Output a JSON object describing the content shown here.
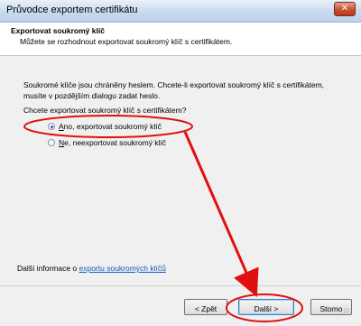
{
  "window": {
    "title": "Průvodce exportem certifikátu",
    "close_label": "✕"
  },
  "header": {
    "title": "Exportovat soukromý klíč",
    "subtitle": "Můžete se rozhodnout exportovat soukromý klíč s certifikátem."
  },
  "body": {
    "paragraph": "Soukromé klíče jsou chráněny heslem. Chcete-li exportovat soukromý klíč s certifikátem, musíte v pozdějším dialogu zadat heslo.",
    "question": "Chcete exportovat soukromý klíč s certifikátem?"
  },
  "options": [
    {
      "accel": "A",
      "rest": "no, exportovat soukromý klíč",
      "selected": true
    },
    {
      "accel": "N",
      "rest": "e, neexportovat soukromý klíč",
      "selected": false
    }
  ],
  "info": {
    "prefix": "Další informace o ",
    "link": "exportu soukromých klíčů"
  },
  "buttons": {
    "back": "< Zpět",
    "next": "Další >",
    "cancel": "Storno"
  },
  "annotation_color": "#e01010"
}
